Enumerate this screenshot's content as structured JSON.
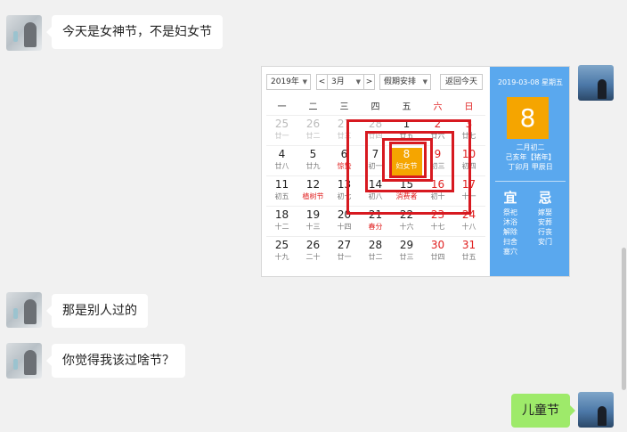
{
  "messages": [
    {
      "side": "left",
      "text": "今天是女神节，不是妇女节"
    },
    {
      "side": "left",
      "text": "那是别人过的"
    },
    {
      "side": "left",
      "text": "你觉得我该过啥节？"
    },
    {
      "side": "right",
      "text": "儿童节"
    }
  ],
  "calendar": {
    "year_select": "2019年",
    "prev_label": "<",
    "month_select": "3月",
    "next_label": ">",
    "holiday_select": "假期安排",
    "today_button": "返回今天",
    "weekdays": [
      "一",
      "二",
      "三",
      "四",
      "五",
      "六",
      "日"
    ],
    "weeks": [
      [
        {
          "n": "25",
          "s": "廿一",
          "g": true
        },
        {
          "n": "26",
          "s": "廿二",
          "g": true
        },
        {
          "n": "27",
          "s": "廿三",
          "g": true
        },
        {
          "n": "28",
          "s": "廿四",
          "g": true
        },
        {
          "n": "1",
          "s": "廿五"
        },
        {
          "n": "2",
          "s": "廿六",
          "w": true
        },
        {
          "n": "3",
          "s": "廿七",
          "w": true
        }
      ],
      [
        {
          "n": "4",
          "s": "廿八"
        },
        {
          "n": "5",
          "s": "廿九"
        },
        {
          "n": "6",
          "s": "惊蛰",
          "h": true
        },
        {
          "n": "7",
          "s": "初一"
        },
        {
          "n": "8",
          "s": "妇女节",
          "t": true
        },
        {
          "n": "9",
          "s": "初三",
          "w": true
        },
        {
          "n": "10",
          "s": "初四",
          "w": true
        }
      ],
      [
        {
          "n": "11",
          "s": "初五"
        },
        {
          "n": "12",
          "s": "植树节",
          "h": true
        },
        {
          "n": "13",
          "s": "初七"
        },
        {
          "n": "14",
          "s": "初八"
        },
        {
          "n": "15",
          "s": "消费者",
          "h": true
        },
        {
          "n": "16",
          "s": "初十",
          "w": true
        },
        {
          "n": "17",
          "s": "十一",
          "w": true
        }
      ],
      [
        {
          "n": "18",
          "s": "十二"
        },
        {
          "n": "19",
          "s": "十三"
        },
        {
          "n": "20",
          "s": "十四"
        },
        {
          "n": "21",
          "s": "春分",
          "h": true
        },
        {
          "n": "22",
          "s": "十六"
        },
        {
          "n": "23",
          "s": "十七",
          "w": true
        },
        {
          "n": "24",
          "s": "十八",
          "w": true
        }
      ],
      [
        {
          "n": "25",
          "s": "十九"
        },
        {
          "n": "26",
          "s": "二十"
        },
        {
          "n": "27",
          "s": "廿一"
        },
        {
          "n": "28",
          "s": "廿二"
        },
        {
          "n": "29",
          "s": "廿三"
        },
        {
          "n": "30",
          "s": "廿四",
          "w": true
        },
        {
          "n": "31",
          "s": "廿五",
          "w": true
        }
      ]
    ],
    "side": {
      "date": "2019-03-08 星期五",
      "day": "8",
      "lunar": "二月初二",
      "ganzhi_year": "己亥年【猪年】",
      "ganzhi_month_day": "丁卯月 甲辰日",
      "yi_label": "宜",
      "ji_label": "忌",
      "yi": [
        "祭祀",
        "沐浴",
        "解除",
        "扫舍",
        "塞穴"
      ],
      "ji": [
        "嫁娶",
        "安葬",
        "行丧",
        "安门"
      ]
    }
  },
  "colors": {
    "accent": "#5aa8ee",
    "today": "#f5a500",
    "highlight": "#d71920",
    "bubble_self": "#9eea6a"
  }
}
